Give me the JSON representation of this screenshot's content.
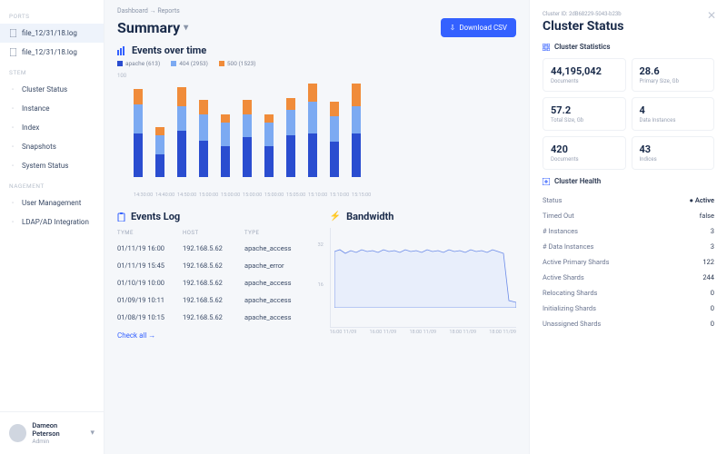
{
  "sidebar": {
    "sections": {
      "reports": "PORTS",
      "system": "STEM",
      "management": "NAGEMENT"
    },
    "reportItems": [
      {
        "label": "file_12/31/18.log",
        "active": true
      },
      {
        "label": "file_12/31/18.log",
        "active": false
      }
    ],
    "systemItems": [
      {
        "label": "Cluster Status"
      },
      {
        "label": "Instance"
      },
      {
        "label": "Index"
      },
      {
        "label": "Snapshots"
      },
      {
        "label": "System Status"
      }
    ],
    "mgmtItems": [
      {
        "label": "User Management"
      },
      {
        "label": "LDAP/AD Integration"
      }
    ],
    "user": {
      "name": "Dameon Peterson",
      "role": "Admin"
    }
  },
  "breadcrumb": "Dashboard  →  Reports",
  "title": "Summary",
  "downloadLabel": "Download CSV",
  "eventsOverTime": {
    "title": "Events over time",
    "legend": [
      {
        "name": "apache",
        "count": "(613)",
        "color": "#2a4dd0"
      },
      {
        "name": "404",
        "count": "(2953)",
        "color": "#7caaf2"
      },
      {
        "name": "500",
        "count": "(1523)",
        "color": "#f08c3a"
      }
    ],
    "ylabel": "100"
  },
  "chart_data": {
    "type": "bar",
    "stacked": true,
    "ylim": [
      0,
      100
    ],
    "categories": [
      "14:30:00",
      "14:40:00",
      "14:50:00",
      "15:00:00",
      "15:00:00",
      "15:00:00",
      "15:00:00",
      "15:05:00",
      "15:10:00",
      "15:10:00",
      "15:15:00"
    ],
    "series": [
      {
        "name": "apache",
        "color": "#2a4dd0",
        "values": [
          42,
          22,
          44,
          35,
          30,
          38,
          30,
          40,
          42,
          34,
          42
        ]
      },
      {
        "name": "404",
        "color": "#7caaf2",
        "values": [
          28,
          18,
          24,
          25,
          22,
          22,
          22,
          24,
          30,
          24,
          26
        ]
      },
      {
        "name": "500",
        "color": "#f08c3a",
        "values": [
          14,
          8,
          18,
          14,
          8,
          14,
          8,
          12,
          18,
          14,
          22
        ]
      }
    ]
  },
  "eventsLog": {
    "title": "Events Log",
    "headers": {
      "time": "TYME",
      "host": "HOST",
      "type": "TYPE"
    },
    "rows": [
      {
        "time": "01/11/19 16:00",
        "host": "192.168.5.62",
        "type": "apache_access"
      },
      {
        "time": "01/11/19 15:45",
        "host": "192.168.5.62",
        "type": "apache_error"
      },
      {
        "time": "01/10/19 10:00",
        "host": "192.168.5.62",
        "type": "apache_access"
      },
      {
        "time": "01/09/19 10:11",
        "host": "192.168.5.62",
        "type": "apache_access"
      },
      {
        "time": "01/08/19 10:15",
        "host": "192.168.5.62",
        "type": "apache_access"
      }
    ],
    "checkAll": "Check all  →"
  },
  "bandwidth": {
    "title": "Bandwidth",
    "ylabels": [
      "32",
      "16"
    ],
    "xlabels": [
      "16:00 11/09",
      "16:00 11/09",
      "18:00 11/09",
      "18:00 11/09",
      "18:00 11/09"
    ]
  },
  "panel": {
    "clusterId": "Cluster ID: 2dB68229-5043-b23b",
    "title": "Cluster Status",
    "statsTitle": "Cluster Statistics",
    "stats": [
      {
        "v": "44,195,042",
        "l": "Documents"
      },
      {
        "v": "28.6",
        "l": "Primary Size, Gb"
      },
      {
        "v": "57.2",
        "l": "Total Size, Gb"
      },
      {
        "v": "4",
        "l": "Data Instances"
      },
      {
        "v": "420",
        "l": "Documents"
      },
      {
        "v": "43",
        "l": "Indices"
      }
    ],
    "healthTitle": "Cluster Health",
    "health": [
      {
        "k": "Status",
        "v": "● Active",
        "cls": "active-dot"
      },
      {
        "k": "Timed Out",
        "v": "false"
      },
      {
        "k": "# Instances",
        "v": "3"
      },
      {
        "k": "# Data Instances",
        "v": "3"
      },
      {
        "k": "Active Primary Shards",
        "v": "122"
      },
      {
        "k": "Active Shards",
        "v": "244"
      },
      {
        "k": "Relocating Shards",
        "v": "0"
      },
      {
        "k": "Initializing Shards",
        "v": "0"
      },
      {
        "k": "Unassigned Shards",
        "v": "0"
      }
    ]
  }
}
